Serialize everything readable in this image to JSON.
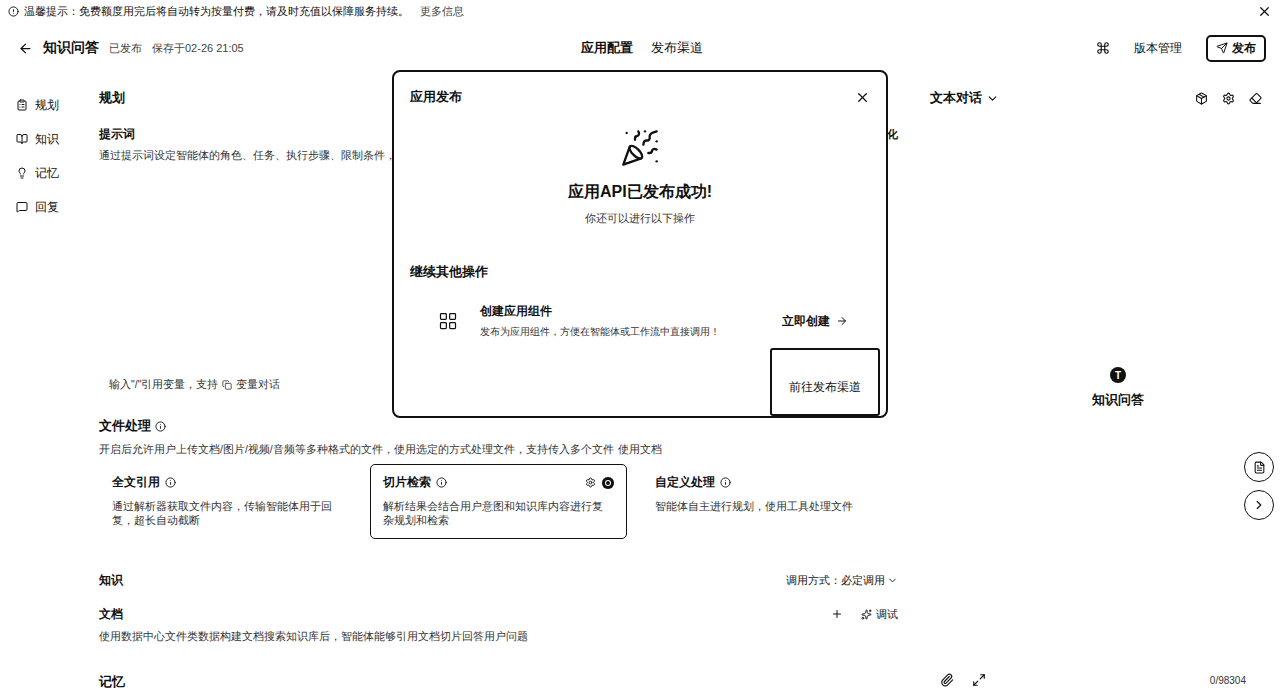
{
  "notice": {
    "text": "温馨提示：免费额度用完后将自动转为按量付费，请及时充值以保障服务持续。",
    "link": "更多信息"
  },
  "header": {
    "title": "知识问答",
    "status": "已发布",
    "saved": "保存于02-26 21:05",
    "tabs": [
      {
        "label": "应用配置",
        "selected": true
      },
      {
        "label": "发布渠道",
        "selected": false
      }
    ],
    "version_button": "版本管理",
    "publish_button": "发布"
  },
  "sidebar": {
    "items": [
      {
        "label": "规划"
      },
      {
        "label": "知识"
      },
      {
        "label": "记忆"
      },
      {
        "label": "回复"
      }
    ]
  },
  "config": {
    "planning": {
      "title": "规划",
      "prompt_label": "提示词",
      "prompt_desc": "通过提示词设定智能体的角色、任务、执行步骤、限制条件，指导智",
      "prompt_aside": "化",
      "hint": "输入\"/\"引用变量，支持",
      "hint_action": "变量对话"
    },
    "file_processing": {
      "title": "文件处理",
      "desc": "开启后允许用户上传文档/图片/视频/音频等多种格式的文件，使用选定的方式处理文件，支持传入多个文件",
      "desc_link": "使用文档",
      "options": [
        {
          "title": "全文引用",
          "desc": "通过解析器获取文件内容，传输智能体用于回复，超长自动截断",
          "selected": false
        },
        {
          "title": "切片检索",
          "desc": "解析结果会结合用户意图和知识库内容进行复杂规划和检索",
          "selected": true
        },
        {
          "title": "自定义处理",
          "desc": "智能体自主进行规划，使用工具处理文件",
          "selected": false
        }
      ]
    },
    "knowledge": {
      "title": "知识",
      "call_mode": "调用方式：必定调用",
      "document": {
        "title": "文档",
        "debug": "调试",
        "desc": "使用数据中心文件类数据构建文档搜索知识库后，智能体能够引用文档切片回答用户问题"
      }
    },
    "memory": {
      "title": "记忆"
    }
  },
  "preview": {
    "mode": "文本对话",
    "avatar": "T",
    "name": "知识问答",
    "counter": "0/98304"
  },
  "dialog": {
    "title": "应用发布",
    "heading": "应用API已发布成功!",
    "subheading": "你还可以进行以下操作",
    "section": "继续其他操作",
    "actions": [
      {
        "title": "创建应用组件",
        "desc": "发布为应用组件，方便在智能体或工作流中直接调用！",
        "link": "立即创建"
      }
    ],
    "primary_button": "前往发布渠道"
  }
}
